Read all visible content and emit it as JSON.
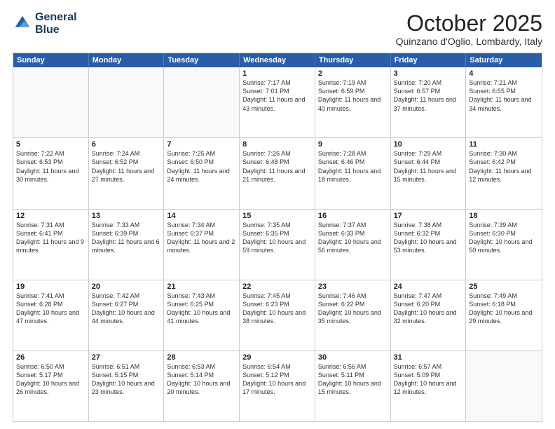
{
  "header": {
    "logo": "GeneralBlue",
    "month": "October 2025",
    "location": "Quinzano d'Oglio, Lombardy, Italy"
  },
  "days_of_week": [
    "Sunday",
    "Monday",
    "Tuesday",
    "Wednesday",
    "Thursday",
    "Friday",
    "Saturday"
  ],
  "rows": [
    [
      {
        "day": "",
        "text": ""
      },
      {
        "day": "",
        "text": ""
      },
      {
        "day": "",
        "text": ""
      },
      {
        "day": "1",
        "text": "Sunrise: 7:17 AM\nSunset: 7:01 PM\nDaylight: 11 hours and 43 minutes."
      },
      {
        "day": "2",
        "text": "Sunrise: 7:19 AM\nSunset: 6:59 PM\nDaylight: 11 hours and 40 minutes."
      },
      {
        "day": "3",
        "text": "Sunrise: 7:20 AM\nSunset: 6:57 PM\nDaylight: 11 hours and 37 minutes."
      },
      {
        "day": "4",
        "text": "Sunrise: 7:21 AM\nSunset: 6:55 PM\nDaylight: 11 hours and 34 minutes."
      }
    ],
    [
      {
        "day": "5",
        "text": "Sunrise: 7:22 AM\nSunset: 6:53 PM\nDaylight: 11 hours and 30 minutes."
      },
      {
        "day": "6",
        "text": "Sunrise: 7:24 AM\nSunset: 6:52 PM\nDaylight: 11 hours and 27 minutes."
      },
      {
        "day": "7",
        "text": "Sunrise: 7:25 AM\nSunset: 6:50 PM\nDaylight: 11 hours and 24 minutes."
      },
      {
        "day": "8",
        "text": "Sunrise: 7:26 AM\nSunset: 6:48 PM\nDaylight: 11 hours and 21 minutes."
      },
      {
        "day": "9",
        "text": "Sunrise: 7:28 AM\nSunset: 6:46 PM\nDaylight: 11 hours and 18 minutes."
      },
      {
        "day": "10",
        "text": "Sunrise: 7:29 AM\nSunset: 6:44 PM\nDaylight: 11 hours and 15 minutes."
      },
      {
        "day": "11",
        "text": "Sunrise: 7:30 AM\nSunset: 6:42 PM\nDaylight: 11 hours and 12 minutes."
      }
    ],
    [
      {
        "day": "12",
        "text": "Sunrise: 7:31 AM\nSunset: 6:41 PM\nDaylight: 11 hours and 9 minutes."
      },
      {
        "day": "13",
        "text": "Sunrise: 7:33 AM\nSunset: 6:39 PM\nDaylight: 11 hours and 6 minutes."
      },
      {
        "day": "14",
        "text": "Sunrise: 7:34 AM\nSunset: 6:37 PM\nDaylight: 11 hours and 2 minutes."
      },
      {
        "day": "15",
        "text": "Sunrise: 7:35 AM\nSunset: 6:35 PM\nDaylight: 10 hours and 59 minutes."
      },
      {
        "day": "16",
        "text": "Sunrise: 7:37 AM\nSunset: 6:33 PM\nDaylight: 10 hours and 56 minutes."
      },
      {
        "day": "17",
        "text": "Sunrise: 7:38 AM\nSunset: 6:32 PM\nDaylight: 10 hours and 53 minutes."
      },
      {
        "day": "18",
        "text": "Sunrise: 7:39 AM\nSunset: 6:30 PM\nDaylight: 10 hours and 50 minutes."
      }
    ],
    [
      {
        "day": "19",
        "text": "Sunrise: 7:41 AM\nSunset: 6:28 PM\nDaylight: 10 hours and 47 minutes."
      },
      {
        "day": "20",
        "text": "Sunrise: 7:42 AM\nSunset: 6:27 PM\nDaylight: 10 hours and 44 minutes."
      },
      {
        "day": "21",
        "text": "Sunrise: 7:43 AM\nSunset: 6:25 PM\nDaylight: 10 hours and 41 minutes."
      },
      {
        "day": "22",
        "text": "Sunrise: 7:45 AM\nSunset: 6:23 PM\nDaylight: 10 hours and 38 minutes."
      },
      {
        "day": "23",
        "text": "Sunrise: 7:46 AM\nSunset: 6:22 PM\nDaylight: 10 hours and 35 minutes."
      },
      {
        "day": "24",
        "text": "Sunrise: 7:47 AM\nSunset: 6:20 PM\nDaylight: 10 hours and 32 minutes."
      },
      {
        "day": "25",
        "text": "Sunrise: 7:49 AM\nSunset: 6:18 PM\nDaylight: 10 hours and 29 minutes."
      }
    ],
    [
      {
        "day": "26",
        "text": "Sunrise: 6:50 AM\nSunset: 5:17 PM\nDaylight: 10 hours and 26 minutes."
      },
      {
        "day": "27",
        "text": "Sunrise: 6:51 AM\nSunset: 5:15 PM\nDaylight: 10 hours and 23 minutes."
      },
      {
        "day": "28",
        "text": "Sunrise: 6:53 AM\nSunset: 5:14 PM\nDaylight: 10 hours and 20 minutes."
      },
      {
        "day": "29",
        "text": "Sunrise: 6:54 AM\nSunset: 5:12 PM\nDaylight: 10 hours and 17 minutes."
      },
      {
        "day": "30",
        "text": "Sunrise: 6:56 AM\nSunset: 5:11 PM\nDaylight: 10 hours and 15 minutes."
      },
      {
        "day": "31",
        "text": "Sunrise: 6:57 AM\nSunset: 5:09 PM\nDaylight: 10 hours and 12 minutes."
      },
      {
        "day": "",
        "text": ""
      }
    ]
  ]
}
